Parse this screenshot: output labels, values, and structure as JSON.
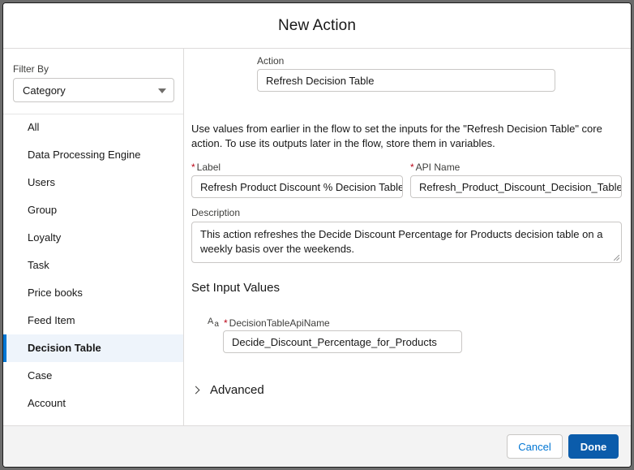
{
  "header": {
    "title": "New Action"
  },
  "sidebar": {
    "filter_label": "Filter By",
    "filter_value": "Category",
    "categories": [
      {
        "label": "All"
      },
      {
        "label": "Data Processing Engine"
      },
      {
        "label": "Users"
      },
      {
        "label": "Group"
      },
      {
        "label": "Loyalty"
      },
      {
        "label": "Task"
      },
      {
        "label": "Price books"
      },
      {
        "label": "Feed Item"
      },
      {
        "label": "Decision Table",
        "selected": true
      },
      {
        "label": "Case"
      },
      {
        "label": "Account"
      }
    ]
  },
  "main": {
    "action_label": "Action",
    "action_value": "Refresh Decision Table",
    "info_text": "Use values from earlier in the flow to set the inputs for the \"Refresh Decision Table\" core action. To use its outputs later in the flow, store them in variables.",
    "label_field": {
      "label": "Label",
      "required_mark": "*",
      "value": "Refresh Product Discount % Decision Table"
    },
    "api_name_field": {
      "label": "API Name",
      "required_mark": "*",
      "value": "Refresh_Product_Discount_Decision_Table"
    },
    "description": {
      "label": "Description",
      "value": "This action refreshes the Decide Discount Percentage for Products decision table on a weekly basis over the weekends."
    },
    "input_section_title": "Set Input Values",
    "input_param": {
      "type_icon": "text-type-icon",
      "type_icon_glyph_main": "A",
      "type_icon_glyph_sub": "a",
      "label": "DecisionTableApiName",
      "required_mark": "*",
      "value": "Decide_Discount_Percentage_for_Products"
    },
    "advanced_label": "Advanced"
  },
  "footer": {
    "cancel_label": "Cancel",
    "done_label": "Done"
  },
  "colors": {
    "brand": "#0176d3",
    "done_button": "#0b5cab",
    "required": "#ba0517",
    "selected_bg": "#eef4fb"
  }
}
